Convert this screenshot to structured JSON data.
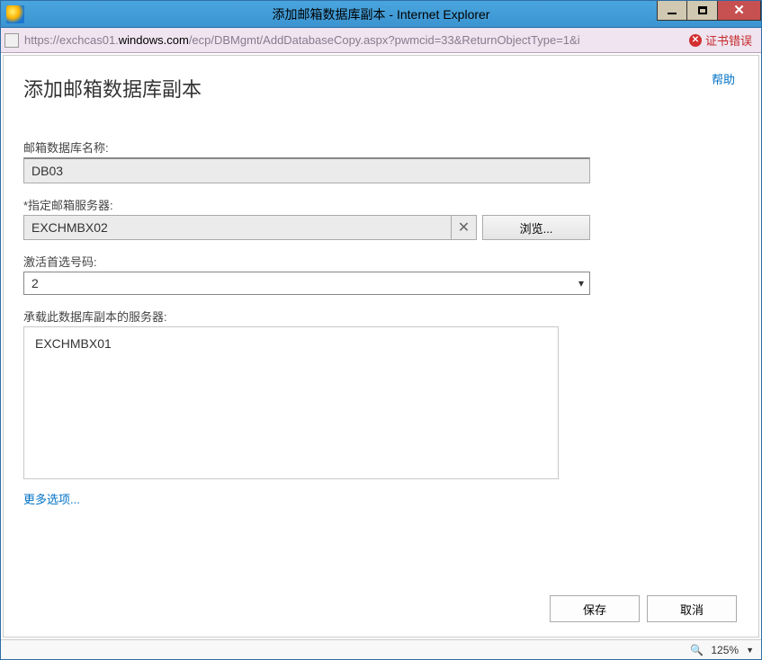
{
  "window": {
    "title": "添加邮箱数据库副本 - Internet Explorer"
  },
  "addressBar": {
    "urlPrefix": "https://exchcas01.",
    "urlDomain": "windows.com",
    "urlSuffix": "/ecp/DBMgmt/AddDatabaseCopy.aspx?pwmcid=33&ReturnObjectType=1&i",
    "certErrorText": "证书错误"
  },
  "page": {
    "helpLink": "帮助",
    "title": "添加邮箱数据库副本",
    "dbNameLabel": "邮箱数据库名称:",
    "dbNameValue": "DB03",
    "serverLabel": "*指定邮箱服务器:",
    "serverValue": "EXCHMBX02",
    "browseLabel": "浏览...",
    "activationLabel": "激活首选号码:",
    "activationValue": "2",
    "hostsLabel": "承载此数据库副本的服务器:",
    "hostsValue": "EXCHMBX01",
    "moreOptions": "更多选项...",
    "saveLabel": "保存",
    "cancelLabel": "取消"
  },
  "statusBar": {
    "zoom": "125%"
  }
}
